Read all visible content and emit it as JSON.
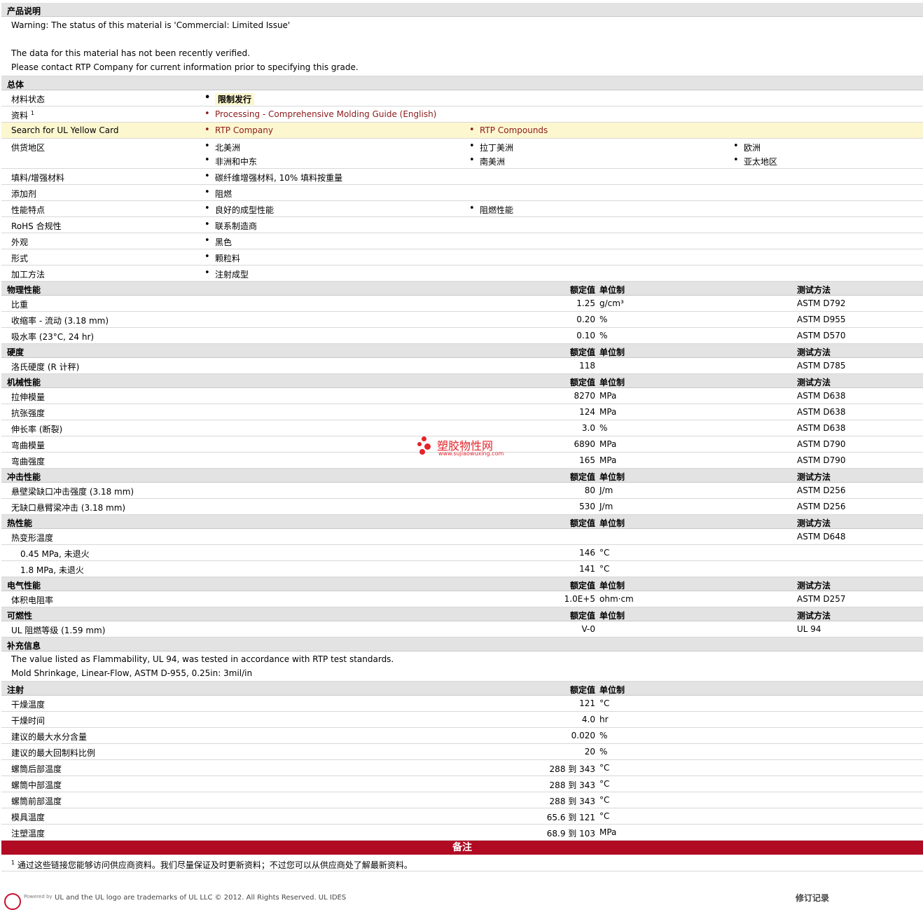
{
  "colors": {
    "link": "#8b1a1a",
    "header_bg": "#e3e3e3",
    "highlight_bg": "#fdf7cf",
    "banner": "#b10a23"
  },
  "col_headers": {
    "value": "额定值",
    "unit": "单位制",
    "test": "测试方法"
  },
  "desc": {
    "title": "产品说明",
    "lines": [
      "Warning: The status of this material is 'Commercial: Limited Issue'",
      "",
      "The data for this material has not been recently verified.",
      "Please contact RTP Company for current information prior to specifying this grade."
    ]
  },
  "general": {
    "title": "总体",
    "status_label": "材料状态",
    "status_value": "限制发行",
    "docs_label": "资料",
    "docs_sup": "1",
    "docs_link": "Processing - Comprehensive Molding Guide (English)",
    "ul_label": "Search for UL Yellow Card",
    "ul_links": [
      "RTP Company",
      "RTP Compounds"
    ],
    "supply_label": "供货地区",
    "supply": [
      "北美洲",
      "拉丁美洲",
      "欧洲",
      "非洲和中东",
      "南美洲",
      "亚太地区"
    ],
    "filler_label": "填料/增强材料",
    "filler": "碳纤维增强材料, 10% 填料按重量",
    "additive_label": "添加剂",
    "additive": "阻燃",
    "features_label": "性能特点",
    "features": [
      "良好的成型性能",
      "阻燃性能"
    ],
    "rohs_label": "RoHS 合规性",
    "rohs": "联系制造商",
    "appearance_label": "外观",
    "appearance": "黑色",
    "form_label": "形式",
    "form": "颗粒料",
    "process_label": "加工方法",
    "process": "注射成型"
  },
  "physical": {
    "title": "物理性能",
    "rows": [
      {
        "label": "比重",
        "value": "1.25",
        "unit": "g/cm³",
        "test": "ASTM D792"
      },
      {
        "label": "收缩率 - 流动 (3.18 mm)",
        "value": "0.20",
        "unit": "%",
        "test": "ASTM D955"
      },
      {
        "label": "吸水率 (23°C, 24 hr)",
        "value": "0.10",
        "unit": "%",
        "test": "ASTM D570"
      }
    ]
  },
  "hardness": {
    "title": "硬度",
    "rows": [
      {
        "label": "洛氏硬度 (R 计秤)",
        "value": "118",
        "unit": "",
        "test": "ASTM D785"
      }
    ]
  },
  "mechanical": {
    "title": "机械性能",
    "rows": [
      {
        "label": "拉伸模量",
        "value": "8270",
        "unit": "MPa",
        "test": "ASTM D638"
      },
      {
        "label": "抗张强度",
        "value": "124",
        "unit": "MPa",
        "test": "ASTM D638"
      },
      {
        "label": "伸长率 (断裂)",
        "value": "3.0",
        "unit": "%",
        "test": "ASTM D638"
      },
      {
        "label": "弯曲模量",
        "value": "6890",
        "unit": "MPa",
        "test": "ASTM D790"
      },
      {
        "label": "弯曲强度",
        "value": "165",
        "unit": "MPa",
        "test": "ASTM D790"
      }
    ]
  },
  "impact": {
    "title": "冲击性能",
    "rows": [
      {
        "label": "悬壁梁缺口冲击强度 (3.18 mm)",
        "value": "80",
        "unit": "J/m",
        "test": "ASTM D256"
      },
      {
        "label": "无缺口悬臂梁冲击 (3.18 mm)",
        "value": "530",
        "unit": "J/m",
        "test": "ASTM D256"
      }
    ]
  },
  "thermal": {
    "title": "热性能",
    "rows": [
      {
        "label": "热变形温度",
        "value": "",
        "unit": "",
        "test": "ASTM D648"
      },
      {
        "label": "0.45 MPa, 未退火",
        "value": "146",
        "unit": "°C",
        "test": ""
      },
      {
        "label": "1.8 MPa, 未退火",
        "value": "141",
        "unit": "°C",
        "test": ""
      }
    ]
  },
  "electrical": {
    "title": "电气性能",
    "rows": [
      {
        "label": "体积电阻率",
        "value": "1.0E+5",
        "unit": "ohm·cm",
        "test": "ASTM D257"
      }
    ]
  },
  "flammability": {
    "title": "可燃性",
    "rows": [
      {
        "label": "UL 阻燃等级 (1.59 mm)",
        "value": "V-0",
        "unit": "",
        "test": "UL 94"
      }
    ]
  },
  "supplemental": {
    "title": "补充信息",
    "lines": [
      "The value listed as Flammability, UL 94, was tested in accordance with RTP test standards.",
      "Mold Shrinkage, Linear-Flow, ASTM D-955, 0.25in: 3mil/in"
    ]
  },
  "injection": {
    "title": "注射",
    "rows": [
      {
        "label": "干燥温度",
        "value": "121",
        "unit": "°C"
      },
      {
        "label": "干燥时间",
        "value": "4.0",
        "unit": "hr"
      },
      {
        "label": "建议的最大水分含量",
        "value": "0.020",
        "unit": "%"
      },
      {
        "label": "建议的最大回制料比例",
        "value": "20",
        "unit": "%"
      },
      {
        "label": "螺筒后部温度",
        "value": "288 到  343",
        "unit": "°C"
      },
      {
        "label": "螺筒中部温度",
        "value": "288 到  343",
        "unit": "°C"
      },
      {
        "label": "螺筒前部温度",
        "value": "288 到  343",
        "unit": "°C"
      },
      {
        "label": "模具温度",
        "value": "65.6 到  121",
        "unit": "°C"
      },
      {
        "label": "注塑温度",
        "value": "68.9 到  103",
        "unit": "MPa"
      }
    ]
  },
  "notes": {
    "title": "备注",
    "sup": "1",
    "text": "通过这些链接您能够访问供应商资料。我们尽量保证及时更新资料；不过您可以从供应商处了解最新资料。"
  },
  "watermark": {
    "title": "塑胶物性网",
    "url": "www.sujiaowuxing.com"
  },
  "footer": {
    "powered": "Powered by",
    "text": "UL and the UL logo are trademarks of UL LLC © 2012. All Rights Reserved. UL IDES",
    "revision": "修订记录"
  }
}
